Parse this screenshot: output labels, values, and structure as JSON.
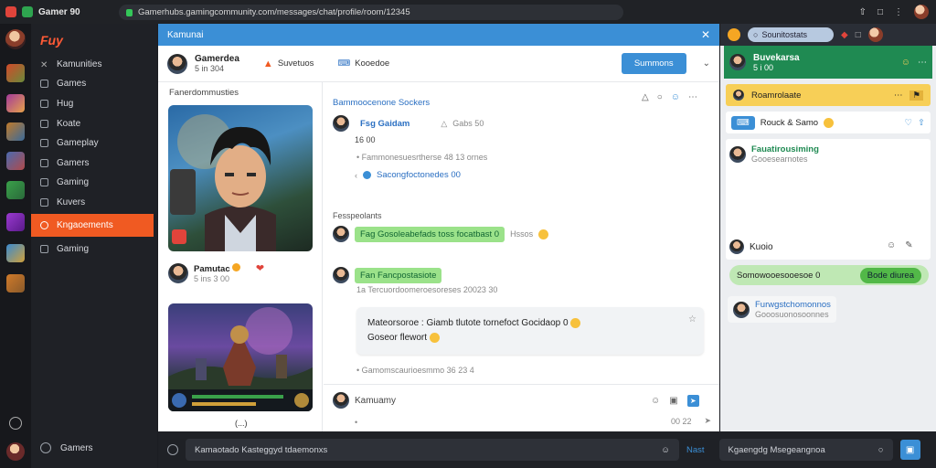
{
  "browser": {
    "tab_title": "Gamer 90",
    "url": "Gamerhubs.gamingcommunity.com/messages/chat/profile/room/12345"
  },
  "sidebar": {
    "logo": "Fuy",
    "items": [
      {
        "label": "Kamunities"
      },
      {
        "label": "Games"
      },
      {
        "label": "Hug"
      },
      {
        "label": "Koate"
      },
      {
        "label": "Gameplay"
      },
      {
        "label": "Gamers"
      },
      {
        "label": "Gaming"
      },
      {
        "label": "Kuvers"
      },
      {
        "label": "Kngaoements"
      },
      {
        "label": "Gaming"
      }
    ],
    "bottom_label": "Gamers"
  },
  "main": {
    "window_title": "Kamunai",
    "header": {
      "name": "Gamerdea",
      "sub": "5 in 304",
      "link1": "Suvetuos",
      "link2": "Kooedoe",
      "button": "Summons"
    },
    "gallery": {
      "title": "Fanerdommusties",
      "author": "Pamutac",
      "author_sub": "5 ins 3 00",
      "caption": "(...)"
    },
    "chat": {
      "heading": "Bammoocenone Sockers",
      "msg1_name": "Fsg Gaidam",
      "msg1_meta": "Gabs 50",
      "msg1_sub": "16 00",
      "msg1_line": "Fammonesuesrtherse 48 13 ornes",
      "msg1_reply": "Sacongfoctonedes 00",
      "section": "Fesspeolants",
      "green1": "Fag Gosoleabefads toss focatbast 0",
      "green1_after": "Hssos",
      "green2": "Fan Fancpostasiote",
      "meta2": "1a  Tercuordoomeroesoreses 20023  30",
      "gray_line1": "Mateorsoroe : Giamb tlutote  tornefoct Gocidaop 0",
      "gray_line2": "Goseor flewort",
      "meta3": "Gamomscaurioesmmo 36 23 4",
      "input_placeholder": "Kamuamy",
      "input_count": "00 22"
    }
  },
  "right": {
    "search": "Sounitostats",
    "green_name": "Buvekarsa",
    "green_sub": "5 i 00",
    "yellow_label": "Roamrolaate",
    "blue_row": "Rouck & Samo",
    "card_name": "Fauatirousiming",
    "card_sub": "Gooesearnotes",
    "card_footer": "Kuoio",
    "green_pill": "Somowooesooesoe 0",
    "green_pill2": "Bode diurea",
    "user_name": "Furwgstchomonnos",
    "user_sub": "Gooosuonosoonnes"
  },
  "bottombar": {
    "input1": "Kamaotado Kasteggyd tdaemonxs",
    "link": "Nast",
    "input2": "Kgaengdg Msegeangnoa"
  },
  "colors": {
    "accent": "#3b8fd6",
    "active": "#f05a22",
    "green": "#1f8a52",
    "yellow": "#f7cf57"
  }
}
